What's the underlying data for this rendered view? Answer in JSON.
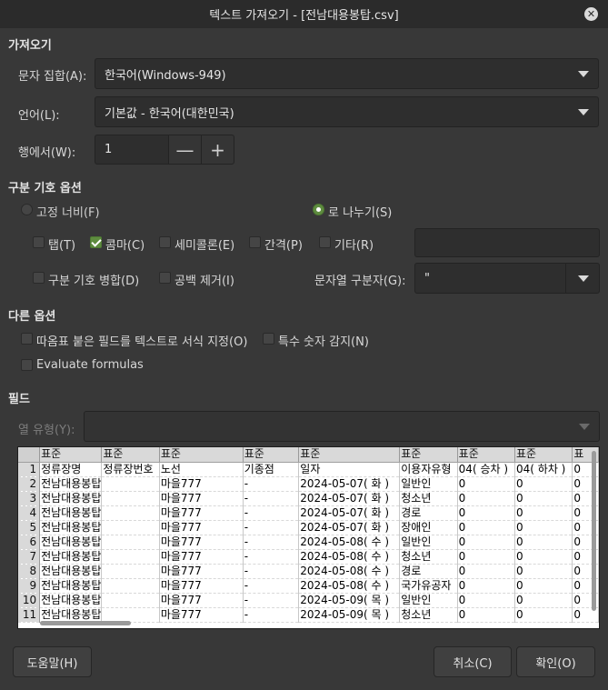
{
  "window": {
    "title": "텍스트 가져오기 - [전남대용봉탑.csv]"
  },
  "import": {
    "section": "가져오기",
    "charset_label": "문자 집합(A):",
    "charset_value": "한국어(Windows-949)",
    "language_label": "언어(L):",
    "language_value": "기본값 - 한국어(대한민국)",
    "from_row_label": "행에서(W):",
    "from_row_value": "1",
    "minus": "—",
    "plus": "+"
  },
  "separator": {
    "section": "구분 기호 옵션",
    "fixed_width": "고정 너비(F)",
    "separated_by": "로 나누기(S)",
    "tab": "탭(T)",
    "comma": "콤마(C)",
    "semicolon": "세미콜론(E)",
    "space": "간격(P)",
    "other": "기타(R)",
    "merge": "구분 기호 병합(D)",
    "trim": "공백 제거(I)",
    "string_delim_label": "문자열 구분자(G):",
    "string_delim_value": "\"",
    "checked": {
      "tab": false,
      "comma": true,
      "semicolon": false,
      "space": false,
      "other": false,
      "merge": false,
      "trim": false
    }
  },
  "other_options": {
    "section": "다른 옵션",
    "quoted_as_text": "따옴표 붙은 필드를 텍스트로 서식 지정(O)",
    "detect_special": "특수 숫자 감지(N)",
    "evaluate": "Evaluate formulas"
  },
  "fields": {
    "section": "필드",
    "column_type_label": "열 유형(Y):",
    "column_type_value": ""
  },
  "preview": {
    "headers": [
      "표준",
      "표준",
      "표준",
      "표준",
      "표준",
      "표준",
      "표준",
      "표준",
      "표"
    ],
    "rows": [
      [
        "1",
        "정류장명",
        "정류장번호",
        "노선",
        "기종점",
        "일자",
        "이용자유형",
        "04( 승차 )",
        "04( 하차 )",
        "0"
      ],
      [
        "2",
        "전남대용봉탑",
        "",
        "마을777",
        "-",
        "2024-05-07( 화 )",
        "일반인",
        "0",
        "0",
        "0"
      ],
      [
        "3",
        "전남대용봉탑",
        "",
        "마을777",
        "-",
        "2024-05-07( 화 )",
        "청소년",
        "0",
        "0",
        "0"
      ],
      [
        "4",
        "전남대용봉탑",
        "",
        "마을777",
        "-",
        "2024-05-07( 화 )",
        "경로",
        "0",
        "0",
        "0"
      ],
      [
        "5",
        "전남대용봉탑",
        "",
        "마을777",
        "-",
        "2024-05-07( 화 )",
        "장애인",
        "0",
        "0",
        "0"
      ],
      [
        "6",
        "전남대용봉탑",
        "",
        "마을777",
        "-",
        "2024-05-08( 수 )",
        "일반인",
        "0",
        "0",
        "0"
      ],
      [
        "7",
        "전남대용봉탑",
        "",
        "마을777",
        "-",
        "2024-05-08( 수 )",
        "청소년",
        "0",
        "0",
        "0"
      ],
      [
        "8",
        "전남대용봉탑",
        "",
        "마을777",
        "-",
        "2024-05-08( 수 )",
        "경로",
        "0",
        "0",
        "0"
      ],
      [
        "9",
        "전남대용봉탑",
        "",
        "마을777",
        "-",
        "2024-05-08( 수 )",
        "국가유공자",
        "0",
        "0",
        "0"
      ],
      [
        "10",
        "전남대용봉탑",
        "",
        "마을777",
        "-",
        "2024-05-09( 목 )",
        "일반인",
        "0",
        "0",
        "0"
      ],
      [
        "11",
        "전남대용봉탑",
        "",
        "마을777",
        "-",
        "2024-05-09( 목 )",
        "청소년",
        "0",
        "0",
        "0"
      ]
    ]
  },
  "buttons": {
    "help": "도움말(H)",
    "cancel": "취소(C)",
    "ok": "확인(O)"
  }
}
